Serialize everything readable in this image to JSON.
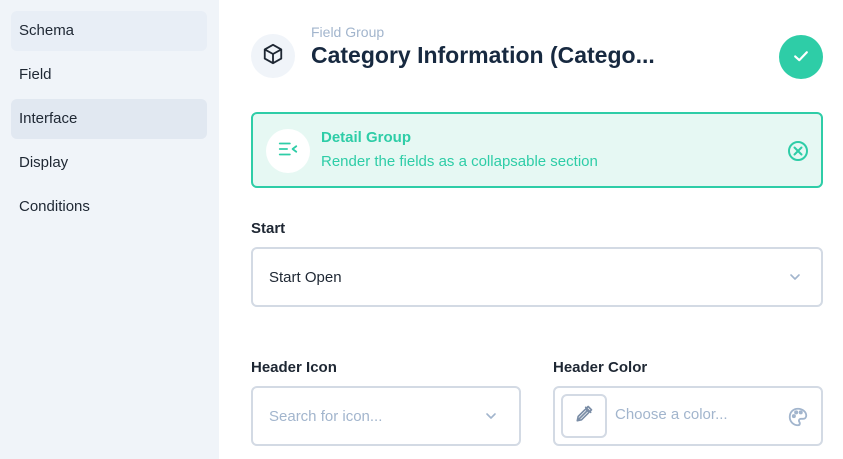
{
  "sidebar": {
    "items": [
      {
        "label": "Schema"
      },
      {
        "label": "Field"
      },
      {
        "label": "Interface"
      },
      {
        "label": "Display"
      },
      {
        "label": "Conditions"
      }
    ]
  },
  "header": {
    "eyebrow": "Field Group",
    "title": "Category Information (Catego...",
    "icon": "box-icon",
    "save_icon": "check-icon"
  },
  "interface_notice": {
    "title": "Detail Group",
    "subtitle": "Render the fields as a collapsable section",
    "icon": "collapse-list-icon",
    "close_icon": "close-circle-icon"
  },
  "fields": {
    "start": {
      "label": "Start",
      "value": "Start Open"
    },
    "header_icon": {
      "label": "Header Icon",
      "placeholder": "Search for icon..."
    },
    "header_color": {
      "label": "Header Color",
      "placeholder": "Choose a color..."
    }
  },
  "colors": {
    "accent": "#2ecda7",
    "sidebar_bg": "#f0f4f9",
    "muted_text": "#a2b5cd",
    "border": "#d3dae4"
  }
}
